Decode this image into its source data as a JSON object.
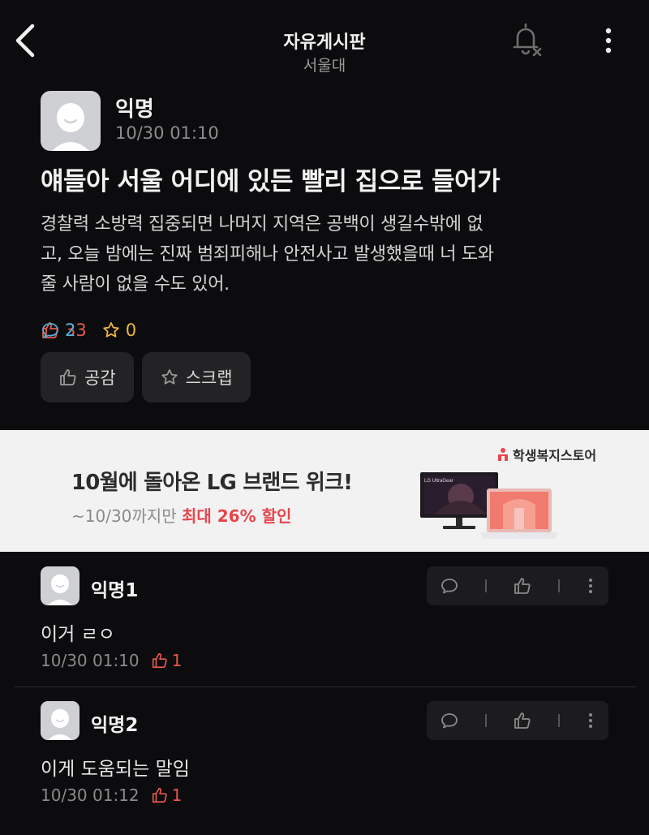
{
  "header": {
    "board_title": "자유게시판",
    "board_subtitle": "서울대"
  },
  "post": {
    "author": "익명",
    "time": "10/30 01:10",
    "title": "얘들아 서울 어디에 있든 빨리 집으로 들어가",
    "body_lines": [
      "경찰력 소방력 집중되면 나머지 지역은 공백이 생길수밖에 없",
      "고, 오늘 밤에는 진짜 범죄피해나 안전사고 발생했을때 너 도와",
      "줄 사람이 없을 수도 있어."
    ],
    "like_count": "33",
    "comment_count": "2",
    "scrap_count": "0",
    "like_button_label": "공감",
    "scrap_button_label": "스크랩"
  },
  "ad": {
    "headline": "10월에 돌아온 LG 브랜드 위크!",
    "sub_prefix": "~10/30까지만",
    "sub_highlight": "최대 26% 할인",
    "store_name": "학생복지스토어",
    "monitor_brand": "LG UltraGear"
  },
  "comments": [
    {
      "author": "익명1",
      "text": "이거 ㄹㅇ",
      "time": "10/30 01:10",
      "likes": "1"
    },
    {
      "author": "익명2",
      "text": "이게 도움되는 말임",
      "time": "10/30 01:12",
      "likes": "1"
    }
  ],
  "colors": {
    "background": "#0c0c0e",
    "like_red": "#e8584f",
    "comment_blue": "#4fb2d8",
    "scrap_yellow": "#f0b63a",
    "ad_highlight": "#e6464b"
  },
  "icons": {
    "back": "chevron-left-icon",
    "notifications_off": "bell-off-icon",
    "more": "more-vertical-icon",
    "like": "thumbs-up-icon",
    "comment": "comment-bubble-icon",
    "scrap": "star-icon"
  }
}
